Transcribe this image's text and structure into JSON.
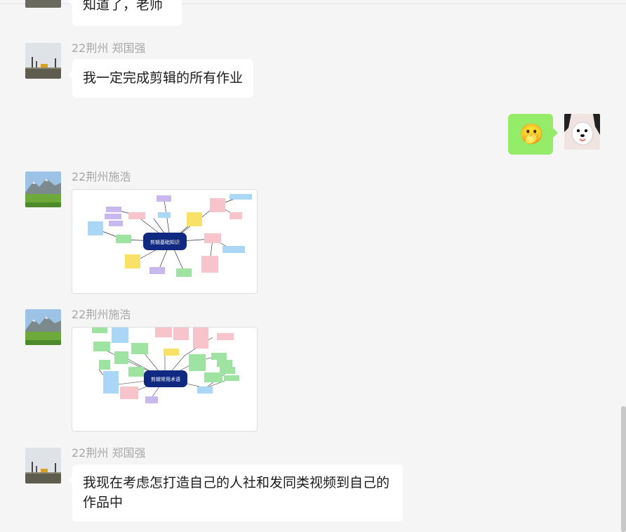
{
  "messages": [
    {
      "text": "知道了，老师"
    },
    {
      "sender": "22荆州 郑国强",
      "text": "我一定完成剪辑的所有作业"
    },
    {
      "emoji": "🫢"
    },
    {
      "sender": "22荆州施浩",
      "image": {
        "center_label": "剪辑基础知识"
      }
    },
    {
      "sender": "22荆州施浩",
      "image": {
        "center_label": "剪辑常用术语"
      }
    },
    {
      "sender": "22荆州 郑国强",
      "text": "我现在考虑怎打造自己的人社和发同类视频到自己的作品中"
    }
  ],
  "colors": {
    "background": "#f5f5f5",
    "bubble_self": "#95ec69",
    "bubble_other": "#ffffff",
    "mindmap_center": "#0f2a80",
    "node_pink": "#f8c4cc",
    "node_purple": "#c9b8ef",
    "node_blue": "#a9d7f5",
    "node_green": "#9fe3a3",
    "node_yellow": "#f9e067"
  },
  "icons": {
    "avatar_tower": "transmission-tower-photo",
    "avatar_dog": "white-dog-photo",
    "avatar_mountain": "mountain-meadow-photo"
  }
}
